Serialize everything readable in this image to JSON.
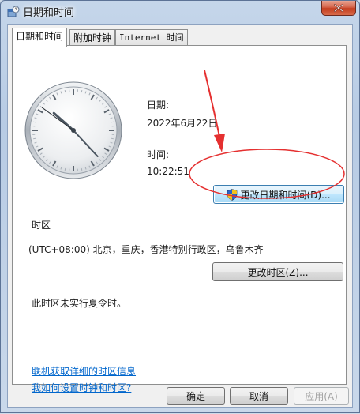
{
  "window": {
    "title": "日期和时间"
  },
  "tabs": [
    {
      "label": "日期和时间"
    },
    {
      "label": "附加时钟"
    },
    {
      "label": "Internet 时间"
    }
  ],
  "datetime": {
    "date_heading": "日期:",
    "date_value": "2022年6月22日",
    "time_heading": "时间:",
    "time_value": "10:22:51",
    "change_button": "更改日期和时间(D)..."
  },
  "clock": {
    "hours": 10,
    "minutes": 22,
    "seconds": 51
  },
  "timezone": {
    "heading": "时区",
    "value": "(UTC+08:00) 北京，重庆，香港特别行政区，乌鲁木齐",
    "change_button": "更改时区(Z)...",
    "dst_note": "此时区未实行夏令时。"
  },
  "links": {
    "online_info": "联机获取详细的时区信息",
    "how_to": "我如何设置时钟和时区?"
  },
  "footer": {
    "ok": "确定",
    "cancel": "取消",
    "apply": "应用(A)"
  },
  "colors": {
    "annotation": "#e53030",
    "link": "#0066cc",
    "focus_button": "#a7d9f5"
  }
}
